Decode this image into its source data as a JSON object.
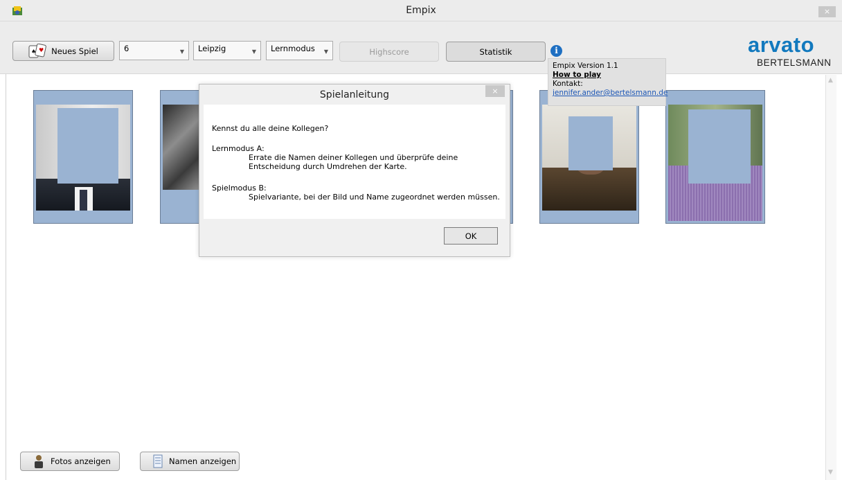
{
  "window": {
    "title": "Empix",
    "close_glyph": "×"
  },
  "toolbar": {
    "new_game_label": "Neues Spiel",
    "count_value": "6",
    "location_value": "Leipzig",
    "mode_value": "Lernmodus",
    "highscore_label": "Highscore",
    "statistics_label": "Statistik",
    "info_glyph": "i"
  },
  "logo": {
    "line1": "arvato",
    "line2": "BERTELSMANN",
    "color": "#1279be"
  },
  "info_tooltip": {
    "version": "Empix Version 1.1",
    "how_to_play": "How to play",
    "contact_label": "Kontakt:",
    "email": "jennifer.ander@bertelsmann.de"
  },
  "cards_count": 6,
  "bottom": {
    "photos_label": "Fotos anzeigen",
    "names_label": "Namen anzeigen"
  },
  "dialog": {
    "title": "Spielanleitung",
    "close_glyph": "×",
    "intro": "Kennst du alle deine Kollegen?",
    "mode_a_title": "Lernmodus A:",
    "mode_a_line1": "Errate die Namen deiner Kollegen und überprüfe deine",
    "mode_a_line2": "Entscheidung durch  Umdrehen der Karte.",
    "mode_b_title": "Spielmodus B:",
    "mode_b_line1": "Spielvariante, bei der Bild und Name zugeordnet werden müssen.",
    "ok_label": "OK"
  },
  "colors": {
    "card_blue": "#9ab3d2",
    "link_blue": "#1a55b5",
    "info_blue": "#1e6fc2"
  },
  "icons": [
    "app-icon",
    "cards-icon",
    "info-icon",
    "person-icon",
    "document-icon",
    "chevron-down-icon",
    "close-icon"
  ]
}
